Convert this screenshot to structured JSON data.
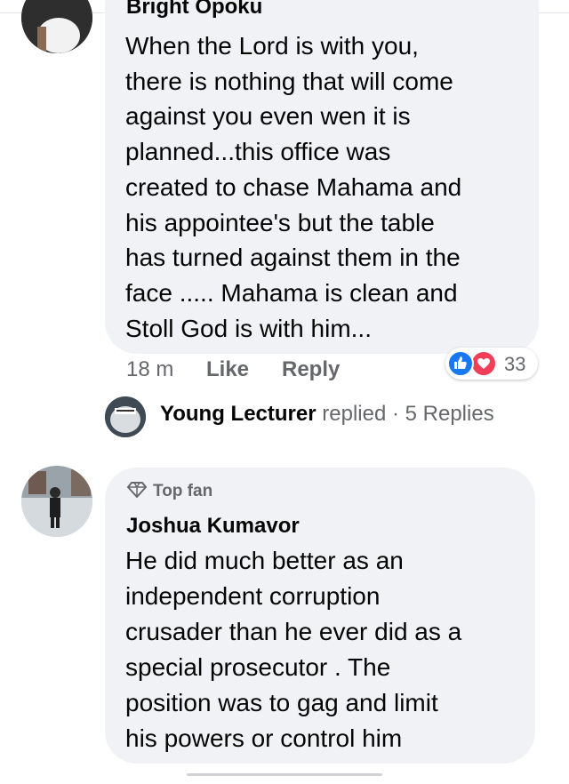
{
  "comments": [
    {
      "author": "Bright Opoku",
      "text": "When the Lord is with you,\nthere is nothing that will come\nagainst you even wen it is\nplanned...this office was\ncreated to chase Mahama and\nhis appointee's but the table\nhas turned against them in the\nface ..... Mahama is clean and\nStoll God is with him...",
      "time": "18 m",
      "like_label": "Like",
      "reply_label": "Reply",
      "reaction_count": "33",
      "replies": {
        "replier": "Young Lecturer",
        "verb": "replied",
        "separator": "·",
        "count_text": "5 Replies"
      }
    },
    {
      "badge": "Top fan",
      "author": "Joshua Kumavor",
      "text": "He did much better as an\nindependent  corruption\ncrusader than he ever did as a\nspecial prosecutor . The\nposition was to gag and limit\nhis powers or control him"
    }
  ]
}
